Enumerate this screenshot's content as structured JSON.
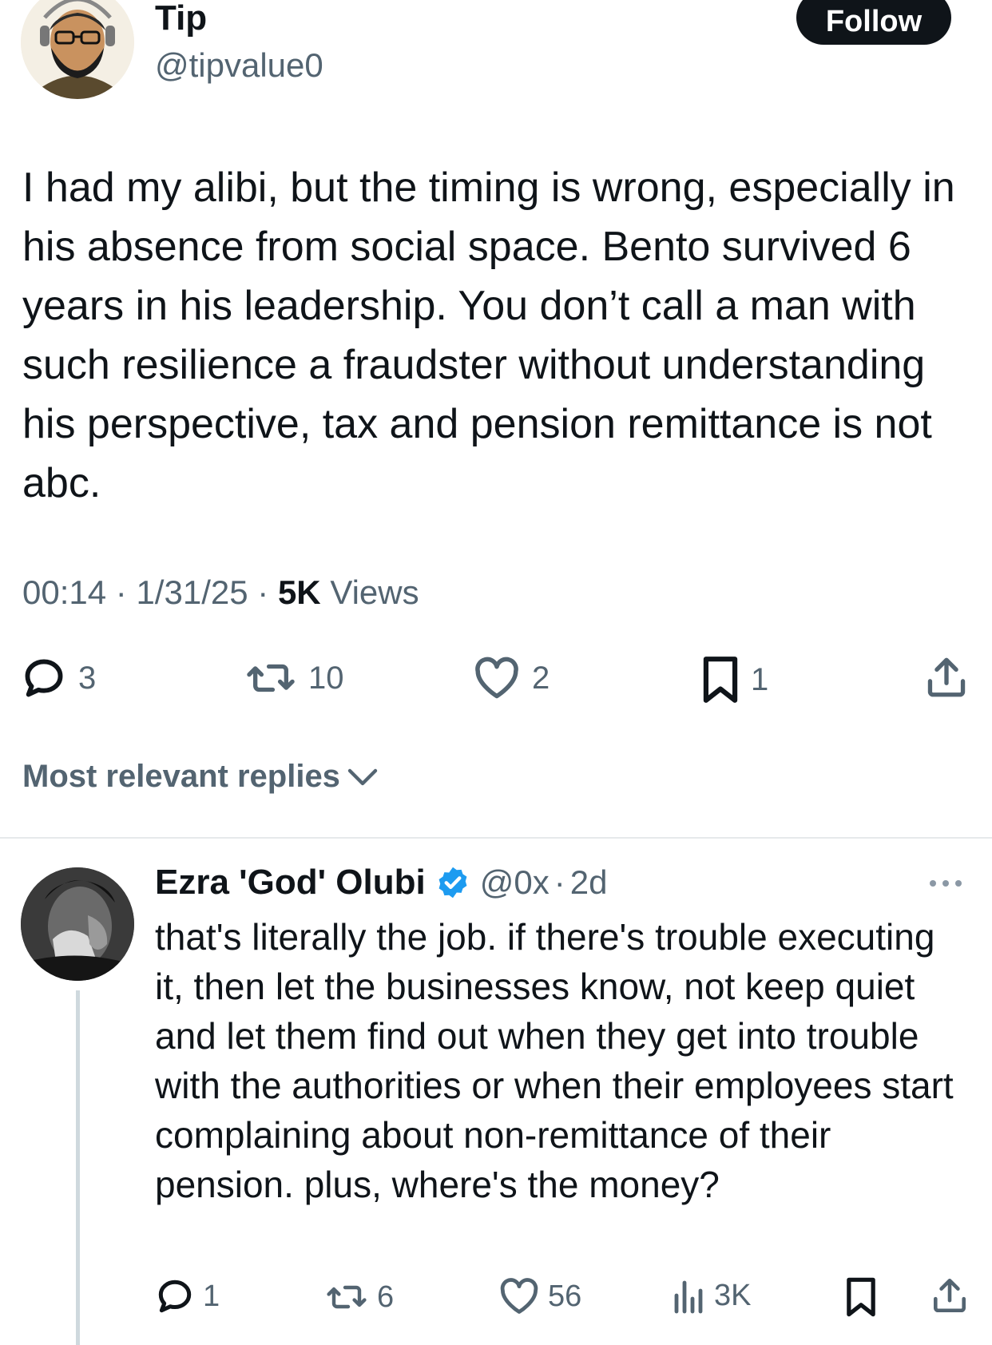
{
  "tweet": {
    "author_name": "Tip",
    "author_handle": "@tipvalue0",
    "follow_label": "Follow",
    "text": "I had my alibi, but the timing is wrong, especially in his absence from social space. Bento survived 6 years in his leadership. You don’t call a man with such resilience a fraudster without understanding his perspective, tax and pension remittance is not abc.",
    "time": "00:14",
    "date": "1/31/25",
    "views_count": "5K",
    "views_label": "Views",
    "sep": "·",
    "actions": {
      "replies": "3",
      "reposts": "10",
      "likes": "2",
      "bookmarks": "1"
    }
  },
  "replies_section": {
    "sort_label": "Most relevant replies"
  },
  "reply": {
    "author_name": "Ezra 'God' Olubi",
    "author_handle": "@0x",
    "sep": "·",
    "time": "2d",
    "text": "that's literally the job. if there's trouble executing it, then let the businesses know, not keep quiet and let them find out when they get into trouble with the authorities or when their employees start complaining about non-remittance of their pension. plus, where's the money?",
    "actions": {
      "replies": "1",
      "reposts": "6",
      "likes": "56",
      "views": "3K"
    }
  },
  "colors": {
    "text_primary": "#0f1419",
    "text_secondary": "#536471",
    "verified_blue": "#1d9bf0",
    "divider": "#e6e9eb"
  },
  "icons": [
    "reply-icon",
    "repost-icon",
    "like-icon",
    "bookmark-icon",
    "share-icon",
    "chevron-down-icon",
    "verified-icon",
    "more-icon",
    "views-icon"
  ]
}
